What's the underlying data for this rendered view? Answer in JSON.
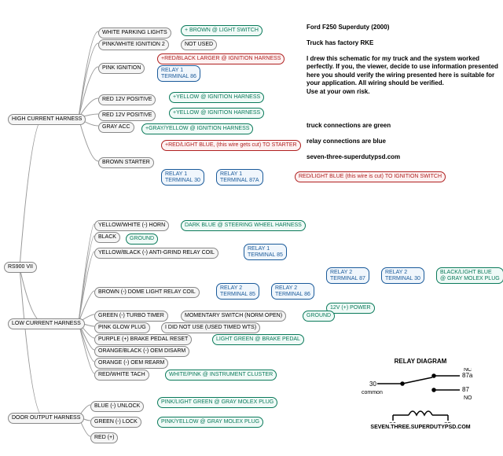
{
  "root": "RS900 VII",
  "info": {
    "title": "Ford F250 Superduty (2000)",
    "line1": "Truck has factory RKE",
    "body": "I drew this schematic for my truck and the system worked perfectly. If you, the viewer, decide to use information presented here you should verify the wiring presented here is suitable for your application. All wiring should be verified.\nUse at your own risk.",
    "line2": "truck connections are green",
    "line3": "relay connections are blue",
    "line4": "seven-three-superdutypsd.com"
  },
  "hc": {
    "label": "HIGH CURRENT HARNESS",
    "w1": "WHITE PARKING LIGHTS",
    "w1t": "+ BROWN @ LIGHT SWITCH",
    "w2": "PINK/WHITE IGNITION 2",
    "w2t": "NOT USED",
    "w3": "PINK IGNITION",
    "w3r": "+RED/BLACK LARGER @ IGNITION HARNESS",
    "w3b1": "RELAY 1\nTERMINAL 86",
    "w4": "RED 12V POSITIVE",
    "w4t": "+YELLOW @ IGNITION HARNESS",
    "w5": "RED 12V POSITIVE",
    "w5t": "+YELLOW @ IGNITION HARNESS",
    "w6": "GRAY ACC",
    "w6t": "+GRAY/YELLOW @ IGNITION HARNESS",
    "w7": "BROWN STARTER",
    "w7r": "+RED/LIGHT BLUE, (this wire gets cut) TO STARTER",
    "w7b1": "RELAY 1\nTERMINAL 30",
    "w7b2": "RELAY 1\nTERMINAL 87A",
    "w7r2": "RED/LIGHT BLUE (this wire is cut) TO IGNITION SWITCH"
  },
  "lc": {
    "label": "LOW CURRENT HARNESS",
    "w1": "YELLOW/WHITE (-) HORN",
    "w1t": "DARK BLUE @ STEERING WHEEL HARNESS",
    "w2": "BLACK",
    "w2t": "GROUND",
    "w3": "YELLOW/BLACK (-) ANTI-GRIND RELAY COIL",
    "w3b": "RELAY 1\nTERMINAL 85",
    "r2a": "RELAY 2\nTERMINAL 87",
    "r2b": "RELAY 2\nTERMINAL 30",
    "r2t": "BLACK/LIGHT BLUE\n@ GRAY MOLEX PLUG",
    "w4": "BROWN (-) DOME LIGHT RELAY COIL",
    "w4b1": "RELAY 2\nTERMINAL 85",
    "w4b2": "RELAY 2\nTERMINAL 86",
    "w4g": "12V (+) POWER",
    "w5": "GREEN (-) TURBO TIMER",
    "w5t": "MOMENTARY SWITCH (NORM OPEN)",
    "w5g": "GROUND",
    "w6": "PINK GLOW PLUG",
    "w6t": "I DID NOT USE (USED TIMED WTS)",
    "w7": "PURPLE (+) BRAKE PEDAL RESET",
    "w7t": "LIGHT GREEN @ BRAKE PEDAL",
    "w8": "ORANGE/BLACK (-) OEM DISARM",
    "w9": "ORANGE (-) OEM REARM",
    "w10": "RED/WHITE TACH",
    "w10t": "WHITE/PINK @ INSTRUMENT CLUSTER"
  },
  "do": {
    "label": "DOOR OUTPUT HARNESS",
    "w1": "BLUE (-) UNLOCK",
    "w1t": "PINK/LIGHT GREEN @ GRAY MOLEX PLUG",
    "w2": "GREEN (-) LOCK",
    "w2t": "PINK/YELLOW @ GRAY MOLEX PLUG",
    "w3": "RED (+)"
  },
  "relay": {
    "title": "RELAY DIAGRAM",
    "p30": "30",
    "p87a": "87a",
    "p87": "87",
    "p86": "86",
    "p85": "85",
    "common": "common",
    "nc": "NC",
    "no": "NO",
    "url": "SEVEN.THREE.SUPERDUTYPSD.COM"
  }
}
